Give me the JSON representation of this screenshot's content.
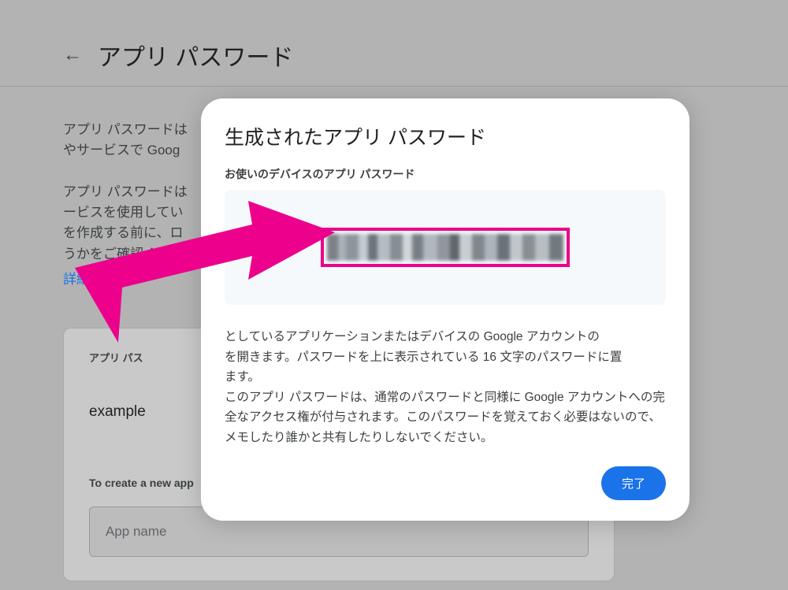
{
  "header": {
    "back_icon": "←",
    "title": "アプリ パスワード"
  },
  "body": {
    "para1": "アプリ パスワードは",
    "para1_cont": "やサービスで Goog",
    "para2_l1": "アプリ パスワードは",
    "para2_l2": "ービスを使用してい",
    "para2_l3": "を作成する前に、ロ",
    "para2_l4": "うかをご確認くださ",
    "details": "詳細"
  },
  "card": {
    "label": "アプリ パス",
    "example": "example",
    "create_label": "To create a new app",
    "input_placeholder": "App name"
  },
  "modal": {
    "title": "生成されたアプリ パスワード",
    "subtitle": "お使いのデバイスのアプリ パスワード",
    "body": "としているアプリケーションまたはデバイスの Google アカウントの　　　　　を開きます。パスワードを上に表示されている 16 文字のパスワードに置　　　　ます。\nこのアプリ パスワードは、通常のパスワードと同様に Google アカウントへの完全なアクセス権が付与されます。このパスワードを覚えておく必要はないので、メモしたり誰かと共有したりしないでください。",
    "done_label": "完了"
  }
}
